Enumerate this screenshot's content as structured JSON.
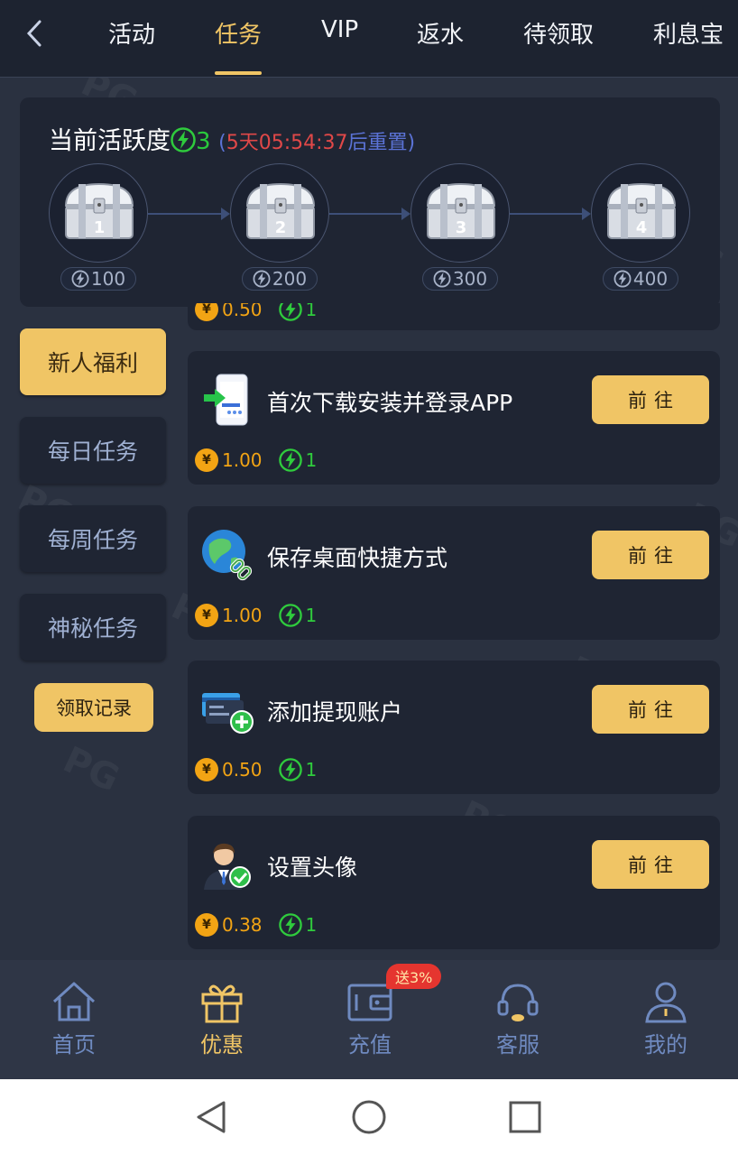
{
  "tabs": [
    {
      "label": "活动",
      "active": false
    },
    {
      "label": "任务",
      "active": true
    },
    {
      "label": "VIP",
      "active": false
    },
    {
      "label": "返水",
      "active": false
    },
    {
      "label": "待领取",
      "active": false
    },
    {
      "label": "利息宝",
      "active": false
    }
  ],
  "activity": {
    "title": "当前活跃度",
    "count": "3",
    "paren_open": "(",
    "timer": "5天05:54:37",
    "suffix": "后重置)",
    "chests": [
      {
        "number": "1",
        "points": "100"
      },
      {
        "number": "2",
        "points": "200"
      },
      {
        "number": "3",
        "points": "300"
      },
      {
        "number": "4",
        "points": "400"
      }
    ]
  },
  "peek": {
    "coin_value": "0.50",
    "bolt_value": "1"
  },
  "sidebar": {
    "items": [
      {
        "label": "新人福利",
        "active": true
      },
      {
        "label": "每日任务",
        "active": false
      },
      {
        "label": "每周任务",
        "active": false
      },
      {
        "label": "神秘任务",
        "active": false
      }
    ],
    "record_label": "领取记录"
  },
  "tasks": [
    {
      "title": "首次下载安装并登录APP",
      "button": "前往",
      "coin": "1.00",
      "bolt": "1",
      "icon": "phone-download-icon"
    },
    {
      "title": "保存桌面快捷方式",
      "button": "前往",
      "coin": "1.00",
      "bolt": "1",
      "icon": "globe-link-icon"
    },
    {
      "title": "添加提现账户",
      "button": "前往",
      "coin": "0.50",
      "bolt": "1",
      "icon": "bank-card-add-icon"
    },
    {
      "title": "设置头像",
      "button": "前往",
      "coin": "0.38",
      "bolt": "1",
      "icon": "avatar-check-icon"
    }
  ],
  "coin_symbol": "¥",
  "bottom_nav": [
    {
      "label": "首页",
      "icon": "home-icon",
      "active": false
    },
    {
      "label": "优惠",
      "icon": "gift-icon",
      "active": true
    },
    {
      "label": "充值",
      "icon": "wallet-icon",
      "active": false
    },
    {
      "label": "客服",
      "icon": "headset-icon",
      "active": false
    },
    {
      "label": "我的",
      "icon": "user-icon",
      "active": false
    }
  ],
  "recharge_badge": "送3%",
  "colors": {
    "accent_gold": "#f0c565",
    "bolt_green": "#2fcb3d",
    "coin_orange": "#f2a414",
    "timer_red": "#e04848",
    "card_bg": "#1f2533",
    "page_bg": "#2a3140"
  }
}
